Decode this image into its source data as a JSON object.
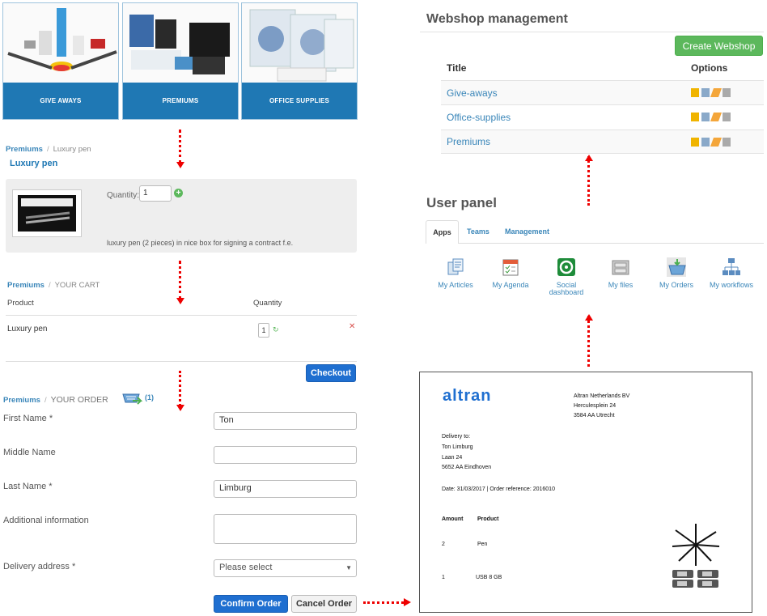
{
  "categories": [
    {
      "label": "GIVE AWAYS"
    },
    {
      "label": "PREMIUMS"
    },
    {
      "label": "OFFICE SUPPLIES"
    }
  ],
  "product_view": {
    "breadcrumb_link": "Premiums",
    "breadcrumb_current": "Luxury pen",
    "title": "Luxury pen",
    "quantity_label": "Quantity:",
    "quantity_value": "1",
    "description": "luxury pen (2 pieces) in nice box for signing a contract f.e."
  },
  "cart": {
    "breadcrumb_link": "Premiums",
    "breadcrumb_current": "YOUR CART",
    "col_product": "Product",
    "col_quantity": "Quantity",
    "rows": [
      {
        "product": "Luxury pen",
        "quantity": "1"
      }
    ],
    "checkout_label": "Checkout"
  },
  "order": {
    "breadcrumb_link": "Premiums",
    "breadcrumb_current": "YOUR ORDER",
    "cart_count": "(1)",
    "first_name_label": "First Name *",
    "first_name_value": "Ton",
    "middle_name_label": "Middle Name",
    "middle_name_value": "",
    "last_name_label": "Last Name *",
    "last_name_value": "Limburg",
    "additional_label": "Additional information",
    "additional_value": "",
    "delivery_label": "Delivery address *",
    "delivery_value": "Please select",
    "confirm_label": "Confirm Order",
    "cancel_label": "Cancel Order"
  },
  "webshop_management": {
    "title": "Webshop management",
    "create_label": "Create Webshop",
    "col_title": "Title",
    "col_options": "Options",
    "rows": [
      {
        "title": "Give-aways"
      },
      {
        "title": "Office-supplies"
      },
      {
        "title": "Premiums"
      }
    ]
  },
  "user_panel": {
    "title": "User panel",
    "tabs": [
      {
        "label": "Apps"
      },
      {
        "label": "Teams"
      },
      {
        "label": "Management"
      }
    ],
    "apps": [
      {
        "label": "My Articles",
        "icon": "articles-icon"
      },
      {
        "label": "My Agenda",
        "icon": "agenda-icon"
      },
      {
        "label": "Social dashboard",
        "icon": "social-icon"
      },
      {
        "label": "My files",
        "icon": "files-icon"
      },
      {
        "label": "My Orders",
        "icon": "orders-icon"
      },
      {
        "label": "My workflows",
        "icon": "workflows-icon"
      }
    ]
  },
  "invoice": {
    "logo": "ALTRAN",
    "company_name": "Altran Netherlands BV",
    "company_street": "Herculesplein 24",
    "company_city": "3584 AA Utrecht",
    "delivery_to": "Delivery to:",
    "recipient": "Ton Limburg",
    "recipient_street": "Laan 24",
    "recipient_city": "5652 AA Eindhoven",
    "date_line": "Date: 31/03/2017 | Order reference: 2016010",
    "col_amount": "Amount",
    "col_product": "Product",
    "lines": [
      {
        "amount": "2",
        "product": "Pen"
      },
      {
        "amount": "1",
        "product": "USB 8 GB"
      }
    ]
  },
  "colors": {
    "brand_blue": "#1f78b4",
    "link_blue": "#3a86b9",
    "arrow_red": "#e00000",
    "create_green": "#5cb85c",
    "button_blue": "#1f6fd0"
  }
}
